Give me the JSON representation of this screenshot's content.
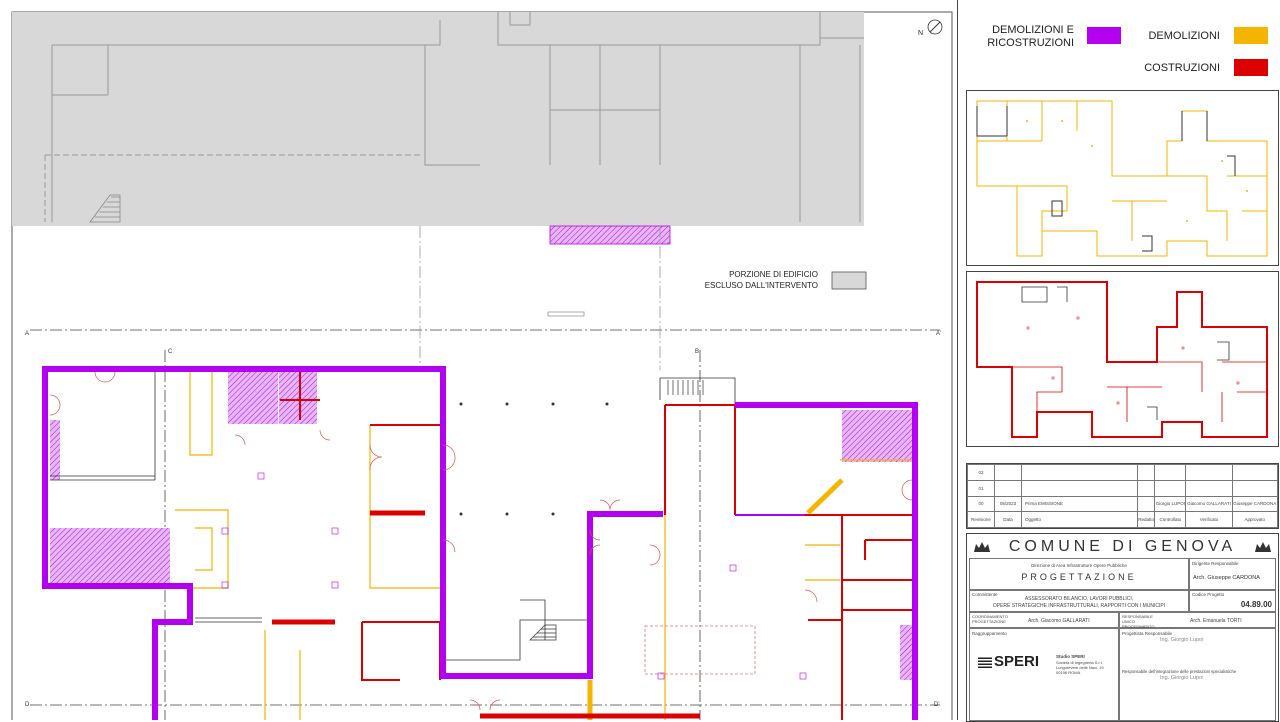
{
  "plan": {
    "north_label": "N",
    "excluded_note": [
      "PORZIONE DI EDIFICIO",
      "ESCLUSO DALL'INTERVENTO"
    ],
    "section_marks": [
      "A",
      "A'",
      "C",
      "B",
      "D",
      "D'"
    ],
    "colors": {
      "demolizioni_ricostruzioni": "#b400f0",
      "demolizioni": "#f5b400",
      "costruzioni": "#dd0000",
      "excluded": "#d8d8d8"
    }
  },
  "legend": {
    "demolizioni_ricostruzioni": [
      "DEMOLIZIONI E",
      "RICOSTRUZIONI"
    ],
    "demolizioni": "DEMOLIZIONI",
    "costruzioni": "COSTRUZIONI"
  },
  "revisions": {
    "rows": [
      {
        "rev": "02",
        "date": "",
        "subject": "",
        "drawn": "",
        "checked": "",
        "verified": "",
        "approved": ""
      },
      {
        "rev": "01",
        "date": "",
        "subject": "",
        "drawn": "",
        "checked": "",
        "verified": "",
        "approved": ""
      },
      {
        "rev": "00",
        "date": "05/2023",
        "subject": "Prima EMISSIONE",
        "drawn": "",
        "checked": "Giorgio LUPOI",
        "verified": "Giacomo GALLARATI",
        "approved": "Giuseppe CARDONA"
      }
    ],
    "headers": [
      "Revisione",
      "Data",
      "Oggetto",
      "Redatto",
      "Controllato",
      "Verificato",
      "Approvato"
    ]
  },
  "title_block": {
    "comune": "COMUNE DI GENOVA",
    "direzione": "Direzione di Area Infrastrutture Opere Pubbliche",
    "progettazione": "PROGETTAZIONE",
    "dirigente_label": "Dirigente Responsabile",
    "dirigente": "Arch. Giuseppe CARDONA",
    "committente_label": "Committente",
    "committente_1": "ASSESSORATO BILANCIO, LAVORI PUBBLICI,",
    "committente_2": "OPERE STRATEGICHE INFRASTRUTTURALI, RAPPORTI CON I MUNICIPI",
    "codice_label": "Codice Progetto",
    "codice": "04.89.00",
    "coordinamento_label": "COORDINAMENTO PROGETTAZIONE",
    "coordinamento": "Arch. Giacomo GALLARATI",
    "rup_label": "RESPONSABILE UNICO PROCEDIMENTO",
    "rup": "Arch. Emanuela TORTI",
    "raggruppamento_label": "Raggruppamento",
    "progettista_label": "Progettista Responsabile",
    "progettista": "Ing. Giorgio Lupoi",
    "integrazione_label": "Responsabile dell'integrazione delle prestazioni specialistiche",
    "integrazione": "Ing. Giorgio Lupoi",
    "studio_logo": "SPERI",
    "studio_name": "Studio SPERI",
    "studio_addr": [
      "Società di Ingegneria S.r.l.",
      "Lungotevere delle Navi, 19",
      "00196 ROMA"
    ]
  }
}
